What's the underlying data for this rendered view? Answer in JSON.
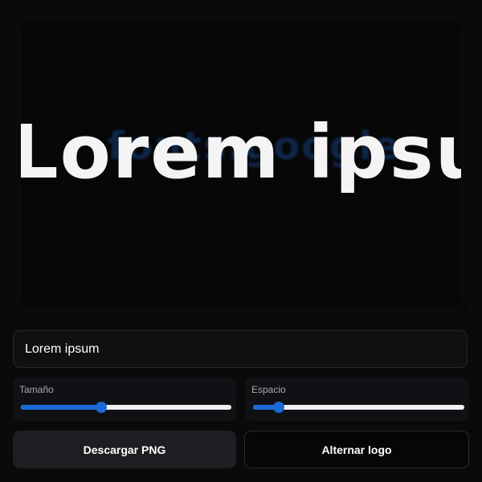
{
  "preview": {
    "logo_text": "fonts.google",
    "display_text": "Lorem ipsum"
  },
  "text_input": {
    "value": "Lorem ipsum"
  },
  "sliders": {
    "size": {
      "label": "Tamaño",
      "value": 0.38
    },
    "spacing": {
      "label": "Espacio",
      "value": 0.12
    }
  },
  "buttons": {
    "download_label": "Descargar PNG",
    "toggle_logo_label": "Alternar logo"
  },
  "colors": {
    "accent": "#1b6ad8",
    "background": "#0a0a0b",
    "ghost_logo": "#11305a"
  }
}
